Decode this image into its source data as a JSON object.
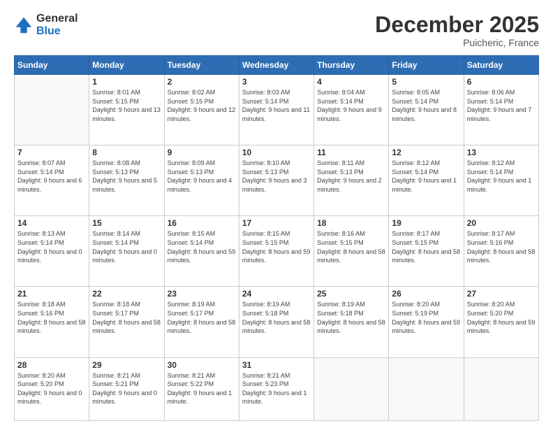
{
  "header": {
    "logo_general": "General",
    "logo_blue": "Blue",
    "month_title": "December 2025",
    "location": "Puicheric, France"
  },
  "weekdays": [
    "Sunday",
    "Monday",
    "Tuesday",
    "Wednesday",
    "Thursday",
    "Friday",
    "Saturday"
  ],
  "weeks": [
    [
      {
        "day": "",
        "sunrise": "",
        "sunset": "",
        "daylight": ""
      },
      {
        "day": "1",
        "sunrise": "Sunrise: 8:01 AM",
        "sunset": "Sunset: 5:15 PM",
        "daylight": "Daylight: 9 hours and 13 minutes."
      },
      {
        "day": "2",
        "sunrise": "Sunrise: 8:02 AM",
        "sunset": "Sunset: 5:15 PM",
        "daylight": "Daylight: 9 hours and 12 minutes."
      },
      {
        "day": "3",
        "sunrise": "Sunrise: 8:03 AM",
        "sunset": "Sunset: 5:14 PM",
        "daylight": "Daylight: 9 hours and 11 minutes."
      },
      {
        "day": "4",
        "sunrise": "Sunrise: 8:04 AM",
        "sunset": "Sunset: 5:14 PM",
        "daylight": "Daylight: 9 hours and 9 minutes."
      },
      {
        "day": "5",
        "sunrise": "Sunrise: 8:05 AM",
        "sunset": "Sunset: 5:14 PM",
        "daylight": "Daylight: 9 hours and 8 minutes."
      },
      {
        "day": "6",
        "sunrise": "Sunrise: 8:06 AM",
        "sunset": "Sunset: 5:14 PM",
        "daylight": "Daylight: 9 hours and 7 minutes."
      }
    ],
    [
      {
        "day": "7",
        "sunrise": "Sunrise: 8:07 AM",
        "sunset": "Sunset: 5:14 PM",
        "daylight": "Daylight: 9 hours and 6 minutes."
      },
      {
        "day": "8",
        "sunrise": "Sunrise: 8:08 AM",
        "sunset": "Sunset: 5:13 PM",
        "daylight": "Daylight: 9 hours and 5 minutes."
      },
      {
        "day": "9",
        "sunrise": "Sunrise: 8:09 AM",
        "sunset": "Sunset: 5:13 PM",
        "daylight": "Daylight: 9 hours and 4 minutes."
      },
      {
        "day": "10",
        "sunrise": "Sunrise: 8:10 AM",
        "sunset": "Sunset: 5:13 PM",
        "daylight": "Daylight: 9 hours and 3 minutes."
      },
      {
        "day": "11",
        "sunrise": "Sunrise: 8:11 AM",
        "sunset": "Sunset: 5:13 PM",
        "daylight": "Daylight: 9 hours and 2 minutes."
      },
      {
        "day": "12",
        "sunrise": "Sunrise: 8:12 AM",
        "sunset": "Sunset: 5:14 PM",
        "daylight": "Daylight: 9 hours and 1 minute."
      },
      {
        "day": "13",
        "sunrise": "Sunrise: 8:12 AM",
        "sunset": "Sunset: 5:14 PM",
        "daylight": "Daylight: 9 hours and 1 minute."
      }
    ],
    [
      {
        "day": "14",
        "sunrise": "Sunrise: 8:13 AM",
        "sunset": "Sunset: 5:14 PM",
        "daylight": "Daylight: 9 hours and 0 minutes."
      },
      {
        "day": "15",
        "sunrise": "Sunrise: 8:14 AM",
        "sunset": "Sunset: 5:14 PM",
        "daylight": "Daylight: 9 hours and 0 minutes."
      },
      {
        "day": "16",
        "sunrise": "Sunrise: 8:15 AM",
        "sunset": "Sunset: 5:14 PM",
        "daylight": "Daylight: 8 hours and 59 minutes."
      },
      {
        "day": "17",
        "sunrise": "Sunrise: 8:15 AM",
        "sunset": "Sunset: 5:15 PM",
        "daylight": "Daylight: 8 hours and 59 minutes."
      },
      {
        "day": "18",
        "sunrise": "Sunrise: 8:16 AM",
        "sunset": "Sunset: 5:15 PM",
        "daylight": "Daylight: 8 hours and 58 minutes."
      },
      {
        "day": "19",
        "sunrise": "Sunrise: 8:17 AM",
        "sunset": "Sunset: 5:15 PM",
        "daylight": "Daylight: 8 hours and 58 minutes."
      },
      {
        "day": "20",
        "sunrise": "Sunrise: 8:17 AM",
        "sunset": "Sunset: 5:16 PM",
        "daylight": "Daylight: 8 hours and 58 minutes."
      }
    ],
    [
      {
        "day": "21",
        "sunrise": "Sunrise: 8:18 AM",
        "sunset": "Sunset: 5:16 PM",
        "daylight": "Daylight: 8 hours and 58 minutes."
      },
      {
        "day": "22",
        "sunrise": "Sunrise: 8:18 AM",
        "sunset": "Sunset: 5:17 PM",
        "daylight": "Daylight: 8 hours and 58 minutes."
      },
      {
        "day": "23",
        "sunrise": "Sunrise: 8:19 AM",
        "sunset": "Sunset: 5:17 PM",
        "daylight": "Daylight: 8 hours and 58 minutes."
      },
      {
        "day": "24",
        "sunrise": "Sunrise: 8:19 AM",
        "sunset": "Sunset: 5:18 PM",
        "daylight": "Daylight: 8 hours and 58 minutes."
      },
      {
        "day": "25",
        "sunrise": "Sunrise: 8:19 AM",
        "sunset": "Sunset: 5:18 PM",
        "daylight": "Daylight: 8 hours and 58 minutes."
      },
      {
        "day": "26",
        "sunrise": "Sunrise: 8:20 AM",
        "sunset": "Sunset: 5:19 PM",
        "daylight": "Daylight: 8 hours and 59 minutes."
      },
      {
        "day": "27",
        "sunrise": "Sunrise: 8:20 AM",
        "sunset": "Sunset: 5:20 PM",
        "daylight": "Daylight: 8 hours and 59 minutes."
      }
    ],
    [
      {
        "day": "28",
        "sunrise": "Sunrise: 8:20 AM",
        "sunset": "Sunset: 5:20 PM",
        "daylight": "Daylight: 9 hours and 0 minutes."
      },
      {
        "day": "29",
        "sunrise": "Sunrise: 8:21 AM",
        "sunset": "Sunset: 5:21 PM",
        "daylight": "Daylight: 9 hours and 0 minutes."
      },
      {
        "day": "30",
        "sunrise": "Sunrise: 8:21 AM",
        "sunset": "Sunset: 5:22 PM",
        "daylight": "Daylight: 9 hours and 1 minute."
      },
      {
        "day": "31",
        "sunrise": "Sunrise: 8:21 AM",
        "sunset": "Sunset: 5:23 PM",
        "daylight": "Daylight: 9 hours and 1 minute."
      },
      {
        "day": "",
        "sunrise": "",
        "sunset": "",
        "daylight": ""
      },
      {
        "day": "",
        "sunrise": "",
        "sunset": "",
        "daylight": ""
      },
      {
        "day": "",
        "sunrise": "",
        "sunset": "",
        "daylight": ""
      }
    ]
  ]
}
